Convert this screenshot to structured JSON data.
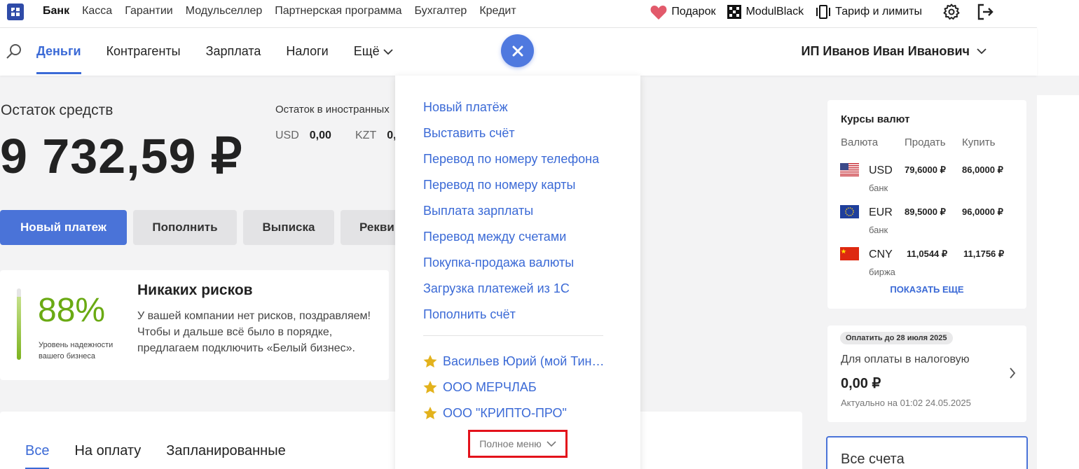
{
  "topnav": {
    "items": [
      "Банк",
      "Касса",
      "Гарантии",
      "Модульселлер",
      "Партнерская программа",
      "Бухгалтер",
      "Кредит"
    ],
    "gift_label": "Подарок",
    "black_label": "ModulBlack",
    "tariff_label": "Тариф и лимиты"
  },
  "mainnav": {
    "tabs": [
      "Деньги",
      "Контрагенты",
      "Зарплата",
      "Налоги",
      "Ещё"
    ],
    "user_name": "ИП Иванов Иван Иванович"
  },
  "balance": {
    "label": "Остаток средств",
    "value": "9 732,59 ₽",
    "foreign_label": "Остаток в иностранных",
    "foreign": [
      {
        "currency": "USD",
        "amount": "0,00"
      },
      {
        "currency": "KZT",
        "amount": "0,"
      }
    ]
  },
  "actions": {
    "new_payment": "Новый платеж",
    "top_up": "Пополнить",
    "statement": "Выписка",
    "requisites": "Рекви"
  },
  "risk": {
    "percent": "88%",
    "level": 0.88,
    "caption": "Уровень надежности вашего бизнеса",
    "title": "Никаких рисков",
    "text": "У вашей компании нет рисков, поздравляем! Чтобы и дальше всё было в порядке, предлагаем подключить «Белый бизнес»."
  },
  "operations": {
    "tabs": [
      "Все",
      "На оплату",
      "Запланированные"
    ]
  },
  "menu": {
    "items": [
      "Новый платёж",
      "Выставить счёт",
      "Перевод по номеру телефона",
      "Перевод по номеру карты",
      "Выплата зарплаты",
      "Перевод между счетами",
      "Покупка-продажа валюты",
      "Загрузка платежей из 1С",
      "Пополнить счёт"
    ],
    "favorites": [
      "Васильев Юрий (мой Тин…",
      "ООО МЕРЧЛАБ",
      "ООО \"КРИПТО-ПРО\""
    ],
    "full_menu_label": "Полное меню"
  },
  "rates": {
    "title": "Курсы валют",
    "headers": [
      "Валюта",
      "Продать",
      "Купить"
    ],
    "rows": [
      {
        "currency": "USD",
        "source": "банк",
        "sell": "79,6000 ₽",
        "buy": "86,0000 ₽",
        "flag": "us-flag"
      },
      {
        "currency": "EUR",
        "source": "банк",
        "sell": "89,5000 ₽",
        "buy": "96,0000 ₽",
        "flag": "eu-flag"
      },
      {
        "currency": "CNY",
        "source": "биржа",
        "sell": "11,0544 ₽",
        "buy": "11,1756 ₽",
        "flag": "cn-flag"
      }
    ],
    "more_label": "ПОКАЗАТЬ ЕЩЕ"
  },
  "tax": {
    "badge": "Оплатить до 28 июля 2025",
    "label": "Для оплаты в налоговую",
    "value": "0,00 ₽",
    "date": "Актуально на 01:02 24.05.2025"
  },
  "accounts": {
    "title": "Все счета"
  },
  "colors": {
    "accent": "#3b6ad6",
    "primary_button": "#4a73d8",
    "risk_green": "#6aaa13",
    "highlight": "#e3121b"
  }
}
